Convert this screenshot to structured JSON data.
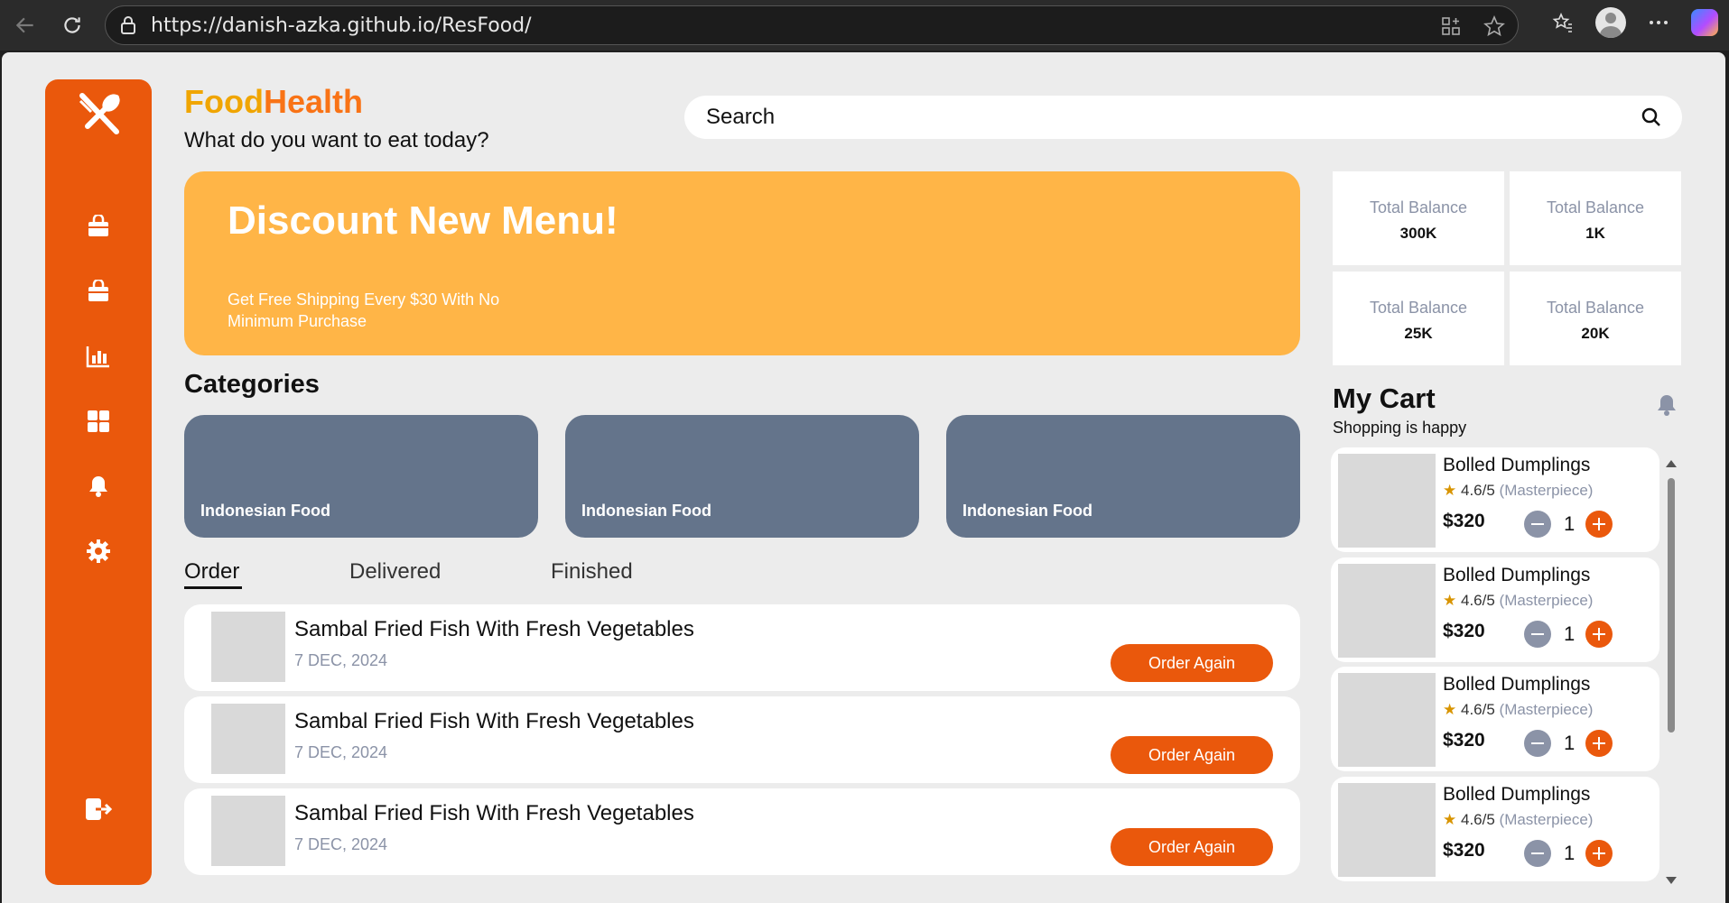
{
  "browser": {
    "url": "https://danish-azka.github.io/ResFood/"
  },
  "header": {
    "brand_part1": "Food",
    "brand_part2": "Health",
    "subtitle": "What do you want to eat today?",
    "search_placeholder": "Search"
  },
  "banner": {
    "title": "Discount New Menu!",
    "text": "Get Free Shipping Every $30 With No Minimum Purchase"
  },
  "stats": [
    {
      "label": "Total Balance",
      "value": "300K"
    },
    {
      "label": "Total Balance",
      "value": "1K"
    },
    {
      "label": "Total Balance",
      "value": "25K"
    },
    {
      "label": "Total Balance",
      "value": "20K"
    }
  ],
  "categories": {
    "title": "Categories",
    "items": [
      "Indonesian Food",
      "Indonesian Food",
      "Indonesian Food"
    ]
  },
  "tabs": [
    "Order",
    "Delivered",
    "Finished"
  ],
  "orders": [
    {
      "name": "Sambal Fried Fish With Fresh Vegetables",
      "date": "7 DEC, 2024",
      "button": "Order Again"
    },
    {
      "name": "Sambal Fried Fish With Fresh Vegetables",
      "date": "7 DEC, 2024",
      "button": "Order Again"
    },
    {
      "name": "Sambal Fried Fish With Fresh Vegetables",
      "date": "7 DEC, 2024",
      "button": "Order Again"
    }
  ],
  "cart": {
    "title": "My Cart",
    "subtitle": "Shopping is happy",
    "items": [
      {
        "name": "Bolled Dumplings",
        "rating": "4.6/5",
        "tag": "(Masterpiece)",
        "price": "$320",
        "qty": "1"
      },
      {
        "name": "Bolled Dumplings",
        "rating": "4.6/5",
        "tag": "(Masterpiece)",
        "price": "$320",
        "qty": "1"
      },
      {
        "name": "Bolled Dumplings",
        "rating": "4.6/5",
        "tag": "(Masterpiece)",
        "price": "$320",
        "qty": "1"
      },
      {
        "name": "Bolled Dumplings",
        "rating": "4.6/5",
        "tag": "(Masterpiece)",
        "price": "$320",
        "qty": "1"
      }
    ]
  },
  "colors": {
    "accent": "#ea580c",
    "banner": "#ffb547",
    "category": "#64748b",
    "muted": "#8b93a7"
  },
  "icons": {
    "sidebar": [
      "fork-knife-icon",
      "shopping-bag-icon",
      "shopping-bag-icon",
      "bar-chart-icon",
      "grid-icon",
      "bell-icon",
      "gear-icon",
      "logout-icon"
    ]
  }
}
